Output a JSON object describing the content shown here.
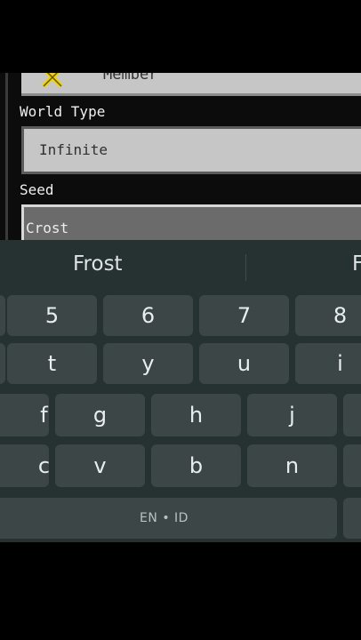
{
  "colors": {
    "game_background": "#0c0c0c",
    "field_light": "#c6c6c6",
    "field_dark": "#6b6b6b",
    "keyboard_background": "#263132",
    "key_background": "#3c4647",
    "key_text": "#e8eded",
    "icon_yellow": "#f2d300"
  },
  "game": {
    "top_row": {
      "partial_text": "Member",
      "icon": "yellow-x-icon"
    },
    "world_type_label": "World Type",
    "world_type_value": "Infinite",
    "seed_label": "Seed",
    "seed_value": "Crost"
  },
  "keyboard": {
    "suggestions": [
      "Frost",
      "F"
    ],
    "rows": [
      [
        "5",
        "6",
        "7",
        "8"
      ],
      [
        "t",
        "y",
        "u",
        "i"
      ],
      [
        "f",
        "g",
        "h",
        "j"
      ],
      [
        "c",
        "v",
        "b",
        "n"
      ]
    ],
    "space_label": "EN • ID"
  }
}
